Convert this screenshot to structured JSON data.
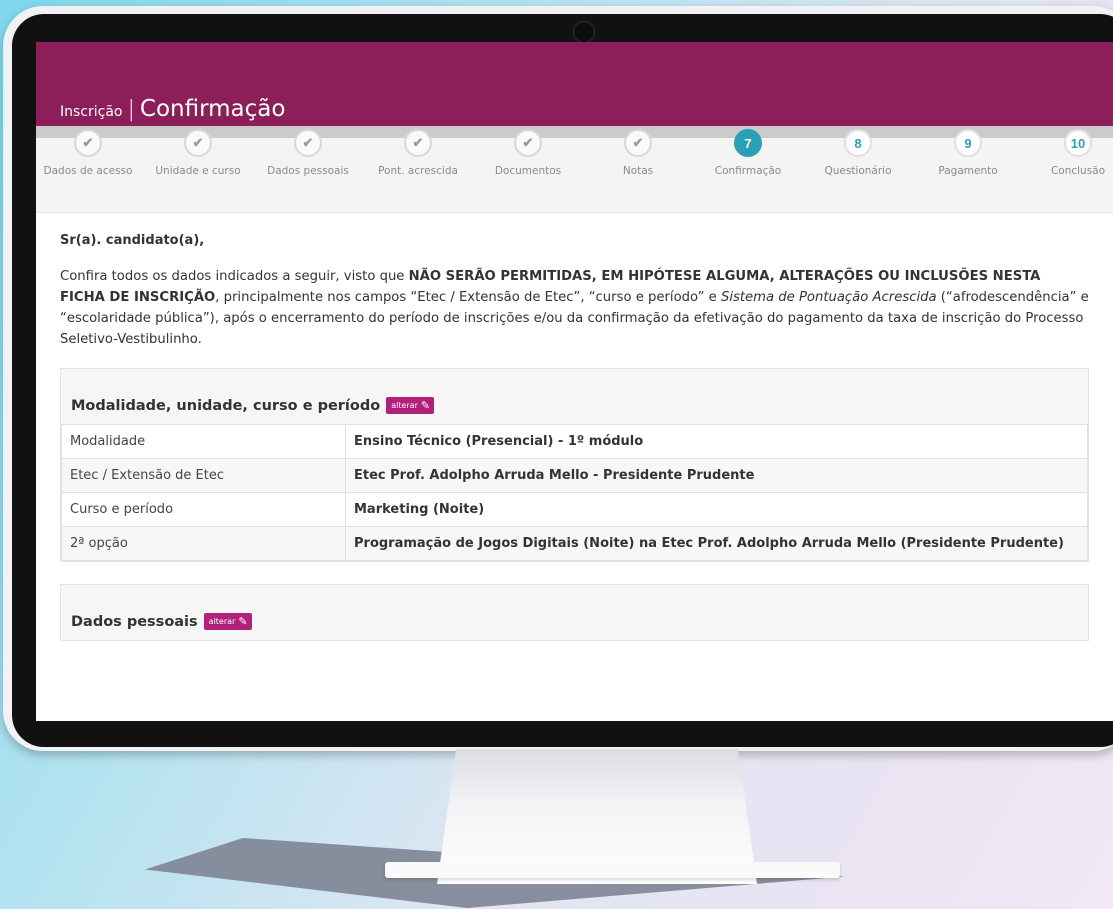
{
  "header": {
    "section": "Inscrição",
    "separator": "|",
    "title": "Confirmação"
  },
  "steps": [
    {
      "number": "✔",
      "label": "Dados de acesso",
      "state": "done"
    },
    {
      "number": "✔",
      "label": "Unidade e curso",
      "state": "done"
    },
    {
      "number": "✔",
      "label": "Dados pessoais",
      "state": "done"
    },
    {
      "number": "✔",
      "label": "Pont. acrescida",
      "state": "done"
    },
    {
      "number": "✔",
      "label": "Documentos",
      "state": "done"
    },
    {
      "number": "✔",
      "label": "Notas",
      "state": "done"
    },
    {
      "number": "7",
      "label": "Confirmação",
      "state": "current"
    },
    {
      "number": "8",
      "label": "Questionário",
      "state": "future"
    },
    {
      "number": "9",
      "label": "Pagamento",
      "state": "future"
    },
    {
      "number": "10",
      "label": "Conclusão",
      "state": "future"
    }
  ],
  "content": {
    "greeting": "Sr(a). candidato(a),",
    "notice": {
      "part1": "Confira todos os dados indicados a seguir, visto que ",
      "bold": "NÃO SERÃO PERMITIDAS, EM HIPÓTESE ALGUMA, ALTERAÇÕES OU INCLUSÕES NESTA FICHA DE INSCRIÇÃO",
      "part2": ", principalmente nos campos “Etec / Extensão de Etec”, “curso e período” e ",
      "italic": "Sistema de Pontuação Acrescida",
      "part3": " (“afrodescendência” e “escolaridade pública”), após o encerramento do período de inscrições e/ou da confirmação da efetivação do pagamento da taxa de inscrição do Processo Seletivo-Vestibulinho."
    }
  },
  "panels": {
    "course": {
      "title": "Modalidade, unidade, curso e período",
      "edit_label": "alterar",
      "rows": [
        {
          "label": "Modalidade",
          "value": "Ensino Técnico (Presencial) - 1º módulo"
        },
        {
          "label": "Etec / Extensão de Etec",
          "value": "Etec Prof. Adolpho Arruda Mello - Presidente Prudente"
        },
        {
          "label": "Curso e período",
          "value": "Marketing (Noite)"
        },
        {
          "label": "2ª opção",
          "value": "Programação de Jogos Digitais (Noite) na Etec Prof. Adolpho Arruda Mello (Presidente Prudente)"
        }
      ]
    },
    "personal": {
      "title": "Dados pessoais",
      "edit_label": "alterar"
    }
  },
  "colors": {
    "header": "#8c1e5a",
    "step_active": "#2aa0b6",
    "edit_button": "#b1217a"
  }
}
